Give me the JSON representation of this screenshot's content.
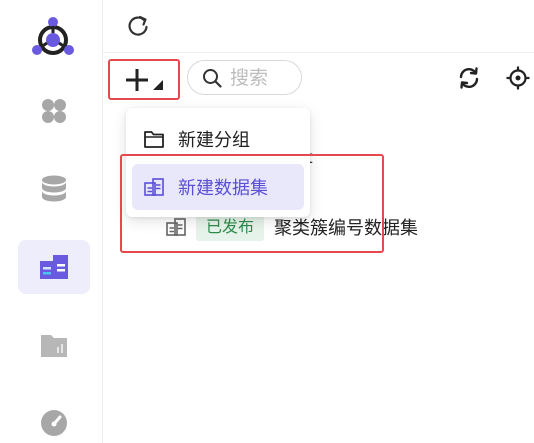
{
  "toolbar": {
    "search_placeholder": "搜索"
  },
  "menu": {
    "items": [
      {
        "label": "新建分组"
      },
      {
        "label": "新建数据集"
      }
    ]
  },
  "tree": {
    "peek_text": "t",
    "dataset": {
      "status": "已发布",
      "name": "聚类簇编号数据集"
    }
  },
  "colors": {
    "accent": "#5b4fd6",
    "active_bg": "#eeedfb",
    "highlight_bg": "#e9e8fb",
    "published_bg": "#e6f3ea",
    "published_text": "#2f8b4b",
    "annotation": "#e5484d"
  }
}
